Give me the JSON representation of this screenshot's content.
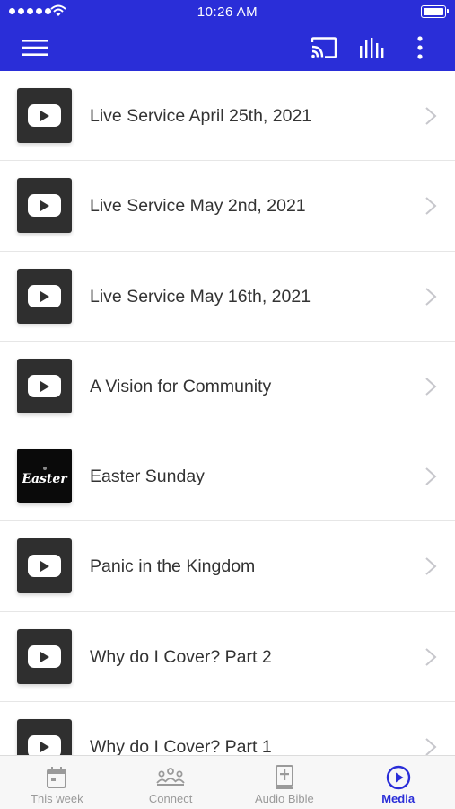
{
  "status_bar": {
    "time": "10:26 AM"
  },
  "app_bar": {
    "menu_icon": "hamburger-menu-icon",
    "cast_icon": "cast-icon",
    "audio_icon": "equalizer-bars-icon",
    "more_icon": "more-vertical-icon",
    "background_color": "#2a2ed8"
  },
  "media_list": [
    {
      "title": "Live Service April 25th, 2021",
      "thumbnail": "youtube-play-icon"
    },
    {
      "title": "Live Service May 2nd, 2021",
      "thumbnail": "youtube-play-icon"
    },
    {
      "title": "Live Service May 16th, 2021",
      "thumbnail": "youtube-play-icon"
    },
    {
      "title": "A Vision for Community",
      "thumbnail": "youtube-play-icon"
    },
    {
      "title": "Easter Sunday",
      "thumbnail": "easter-image",
      "thumbnail_text": "Easter"
    },
    {
      "title": "Panic in the Kingdom",
      "thumbnail": "youtube-play-icon"
    },
    {
      "title": "Why do I Cover? Part 2",
      "thumbnail": "youtube-play-icon"
    },
    {
      "title": "Why do I Cover? Part 1",
      "thumbnail": "youtube-play-icon"
    }
  ],
  "tab_bar": {
    "tabs": [
      {
        "label": "This week",
        "icon": "calendar-icon",
        "active": false
      },
      {
        "label": "Connect",
        "icon": "people-group-icon",
        "active": false
      },
      {
        "label": "Audio Bible",
        "icon": "bible-icon",
        "active": false
      },
      {
        "label": "Media",
        "icon": "play-circle-icon",
        "active": true
      }
    ],
    "active_color": "#2a2ed8",
    "inactive_color": "#9a9a9a"
  }
}
